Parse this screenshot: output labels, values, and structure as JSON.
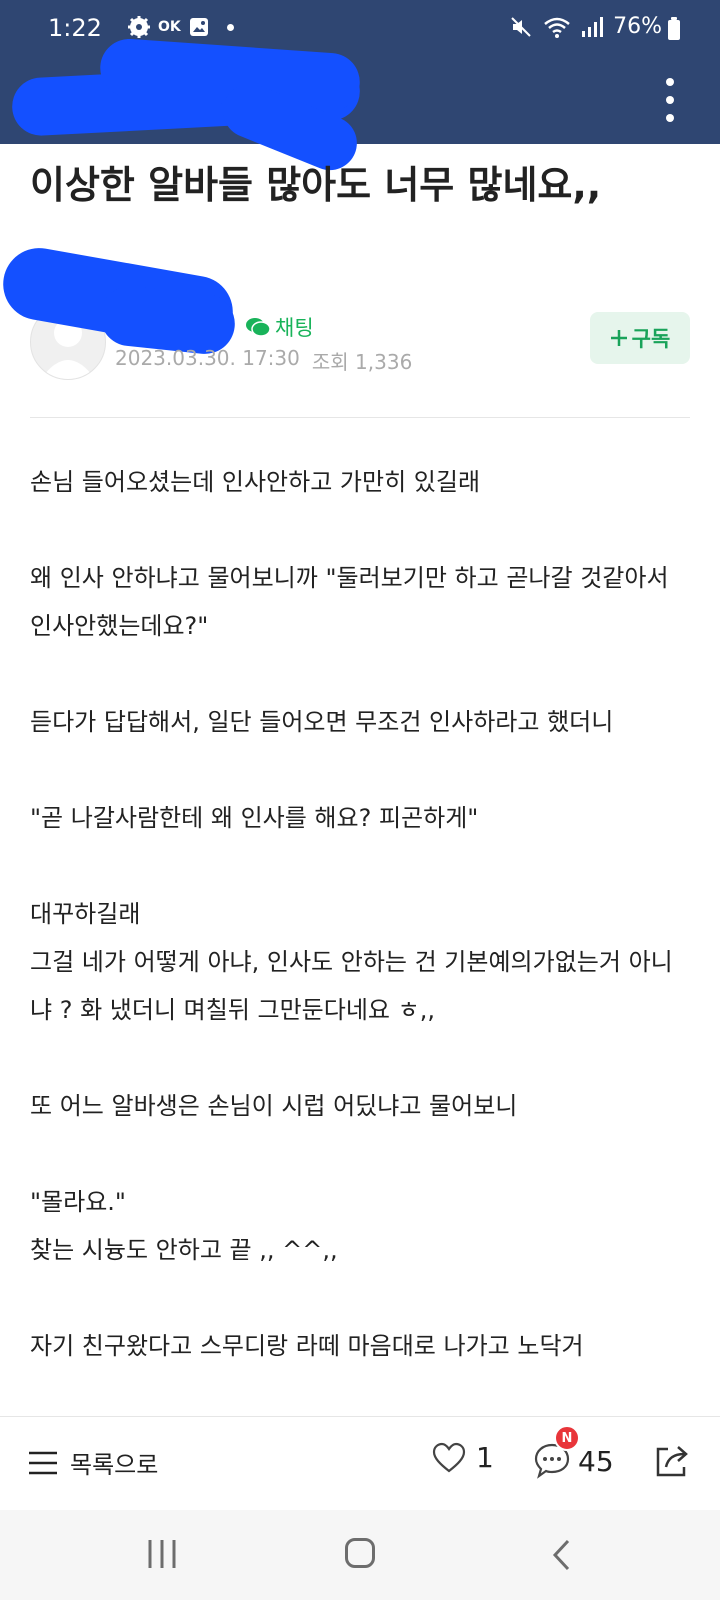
{
  "status_bar": {
    "time": "1:22",
    "left_icons": [
      "settings-gear-icon",
      "ok-icon",
      "gallery-icon",
      "dot-icon"
    ],
    "ok_label": "OK",
    "battery": "76%"
  },
  "post": {
    "title": "이상한 알바들 많아도 너무 많네요,,",
    "chat_label": "채팅",
    "date": "2023.03.30. 17:30",
    "views": "조회 1,336",
    "subscribe_label": "구독",
    "body": [
      "손님 들어오셨는데 인사안하고 가만히 있길래",
      "",
      "왜 인사 안하냐고 물어보니까 \"둘러보기만 하고 곧나갈 것같아서 인사안했는데요?\"",
      "",
      "듣다가 답답해서, 일단 들어오면 무조건 인사하라고 했더니",
      "",
      "\"곧 나갈사람한테 왜 인사를 해요? 피곤하게\"",
      "",
      "대꾸하길래",
      "그걸 네가 어떻게 아냐, 인사도 안하는 건 기본예의가없는거 아니냐 ? 화 냈더니 며칠뒤 그만둔다네요 ㅎ,,",
      "",
      "또 어느 알바생은 손님이 시럽 어딨냐고 물어보니",
      "",
      "\"몰라요.\"",
      "찾는 시늉도 안하고 끝 ,, ^^,,",
      "",
      "자기 친구왔다고 스무디랑 라떼 마음대로 나가고 노닥거"
    ]
  },
  "bottom_bar": {
    "list_label": "목록으로",
    "like_count": "1",
    "comment_count": "45",
    "comment_badge": "N"
  },
  "colors": {
    "header": "#2f4672",
    "accent_green": "#19b35a",
    "subscribe_bg": "#e6f5ec",
    "redaction": "#1450ff",
    "badge_red": "#e8353a"
  }
}
